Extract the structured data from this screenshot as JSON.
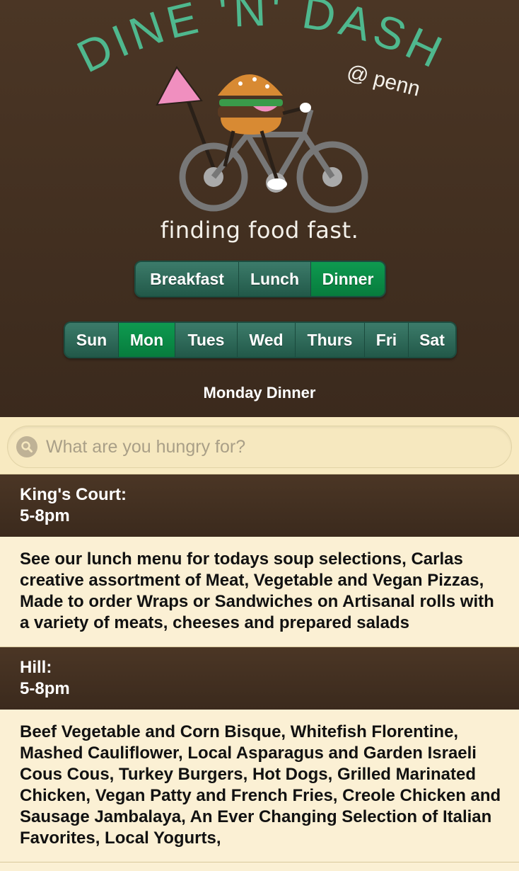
{
  "logo": {
    "title": "DINE 'N' DASH",
    "subtitle": "@ penn",
    "tagline": "finding food fast."
  },
  "meals": [
    {
      "label": "Breakfast",
      "active": false
    },
    {
      "label": "Lunch",
      "active": false
    },
    {
      "label": "Dinner",
      "active": true
    }
  ],
  "days": [
    {
      "label": "Sun",
      "active": false
    },
    {
      "label": "Mon",
      "active": true
    },
    {
      "label": "Tues",
      "active": false
    },
    {
      "label": "Wed",
      "active": false
    },
    {
      "label": "Thurs",
      "active": false
    },
    {
      "label": "Fri",
      "active": false
    },
    {
      "label": "Sat",
      "active": false
    }
  ],
  "page_title": "Monday Dinner",
  "search": {
    "placeholder": "What are you hungry for?"
  },
  "sections": [
    {
      "name": "King's Court:",
      "hours": "5-8pm",
      "menu": "See our lunch menu for todays soup selections, Carlas creative assortment of Meat, Vegetable and Vegan Pizzas, Made to order Wraps or Sandwiches on Artisanal rolls with a variety of meats, cheeses and prepared salads"
    },
    {
      "name": "Hill:",
      "hours": "5-8pm",
      "menu": "Beef Vegetable and Corn Bisque, Whitefish Florentine, Mashed Cauliflower, Local Asparagus and Garden Israeli Cous Cous, Turkey Burgers, Hot Dogs, Grilled Marinated Chicken, Vegan Patty and French Fries, Creole Chicken and Sausage Jambalaya, An Ever Changing Selection of Italian Favorites, Local Yogurts,"
    }
  ],
  "colors": {
    "header_brown": "#3f2d20",
    "button_teal": "#2f6b5b",
    "button_active_green": "#0a8c45",
    "logo_teal": "#4fb88e",
    "flag_pink": "#f08fbf",
    "cream": "#fbf0d4"
  },
  "icons": {
    "search": "search-icon"
  }
}
